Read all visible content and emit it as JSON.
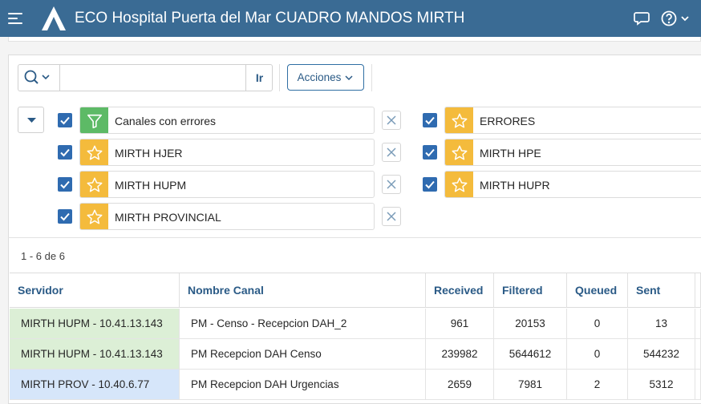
{
  "header": {
    "title": "ECO Hospital Puerta del Mar CUADRO MANDOS MIRTH",
    "icons": [
      "menu-icon",
      "logo-icon",
      "chat-icon",
      "help-icon",
      "chevron-down-icon"
    ]
  },
  "toolbar": {
    "search_value": "",
    "go_label": "Ir",
    "actions_label": "Acciones"
  },
  "filters": [
    {
      "label": "Canales con errores",
      "icon": "filter-icon",
      "icon_color": "#5dba66"
    },
    {
      "label": "ERRORES",
      "icon": "star-icon",
      "icon_color": "#f4bb3c"
    },
    {
      "label": "MIRTH HJER",
      "icon": "star-icon",
      "icon_color": "#f4bb3c"
    },
    {
      "label": "MIRTH HPE",
      "icon": "star-icon",
      "icon_color": "#f4bb3c"
    },
    {
      "label": "MIRTH HUPM",
      "icon": "star-icon",
      "icon_color": "#f4bb3c"
    },
    {
      "label": "MIRTH HUPR",
      "icon": "star-icon",
      "icon_color": "#f4bb3c"
    },
    {
      "label": "MIRTH PROVINCIAL",
      "icon": "star-icon",
      "icon_color": "#f4bb3c"
    }
  ],
  "pagination": {
    "text": "1 - 6 de 6"
  },
  "table": {
    "columns": [
      "Servidor",
      "Nombre Canal",
      "Received",
      "Filtered",
      "Queued",
      "Sent"
    ],
    "rows": [
      {
        "servidor": "MIRTH HUPM - 10.41.13.143",
        "canal": "PM - Censo - Recepcion DAH_2",
        "received": "961",
        "filtered": "20153",
        "queued": "0",
        "sent": "13",
        "color": "#dcefd6"
      },
      {
        "servidor": "MIRTH HUPM - 10.41.13.143",
        "canal": "PM Recepcion DAH Censo",
        "received": "239982",
        "filtered": "5644612",
        "queued": "0",
        "sent": "544232",
        "color": "#dcefd6"
      },
      {
        "servidor": "MIRTH PROV - 10.40.6.77",
        "canal": "PM Recepcion DAH Urgencias",
        "received": "2659",
        "filtered": "7981",
        "queued": "2",
        "sent": "5312",
        "color": "#d6e6fa"
      }
    ]
  },
  "colors": {
    "header_bg": "#3a6b94",
    "link": "#2a5a86",
    "checkbox": "#2f6bb0"
  }
}
